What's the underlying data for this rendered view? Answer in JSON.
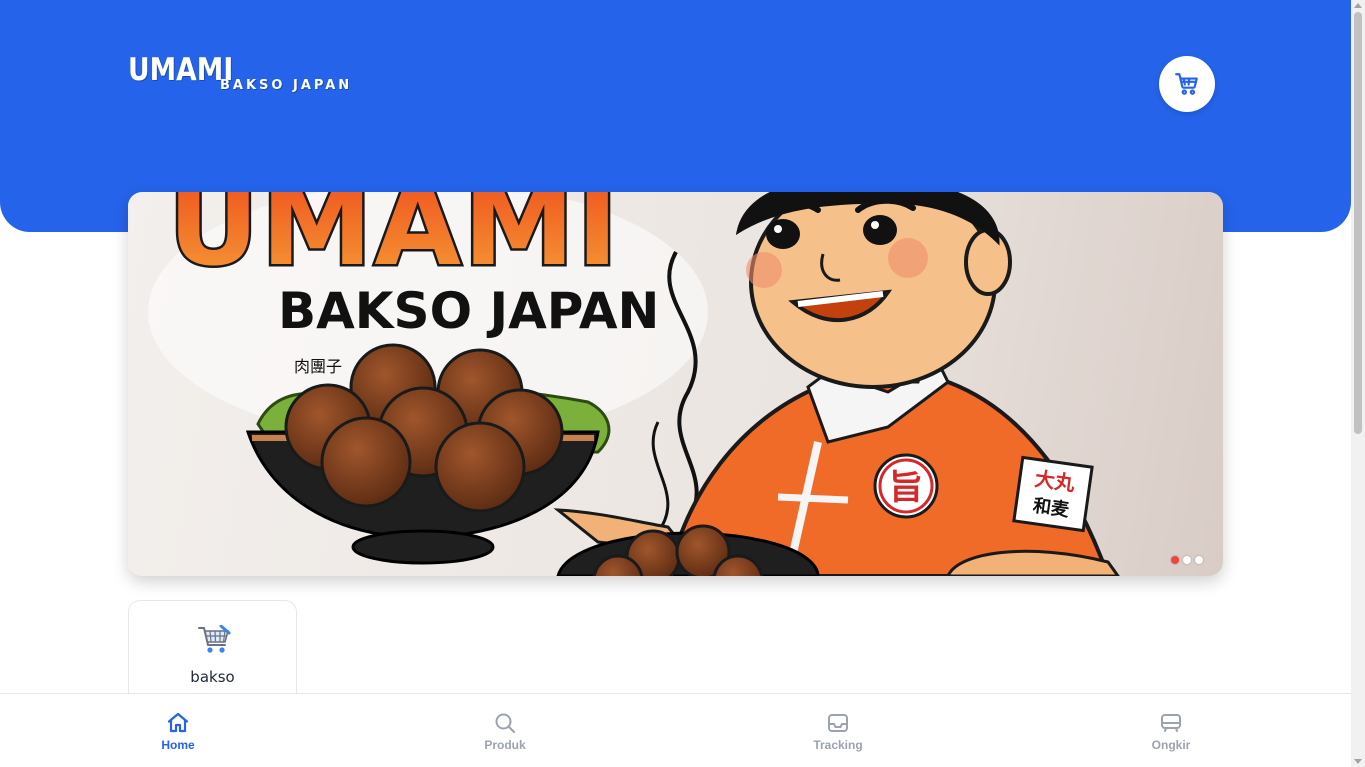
{
  "brand": {
    "main": "UMAMI",
    "sub": "BAKSO JAPAN"
  },
  "header": {
    "cart_icon": "cart-icon",
    "color": "#2563eb"
  },
  "banner": {
    "headline": "UMAMI",
    "subline": "BAKSO JAPAN",
    "jp_text": "肉團子",
    "chest_badge": "旨",
    "sleeve_text_1": "大丸",
    "sleeve_text_2": "和麦",
    "slides": 3,
    "active_slide": 1
  },
  "categories": [
    {
      "label": "bakso",
      "icon": "shopping-cart-icon"
    }
  ],
  "nav": {
    "active_color": "#2563eb",
    "inactive_color": "#9ca3af",
    "items": [
      {
        "label": "Home",
        "icon": "home-icon",
        "active": true
      },
      {
        "label": "Produk",
        "icon": "search-icon",
        "active": false
      },
      {
        "label": "Tracking",
        "icon": "inbox-icon",
        "active": false
      },
      {
        "label": "Ongkir",
        "icon": "truck-icon",
        "active": false
      }
    ]
  }
}
